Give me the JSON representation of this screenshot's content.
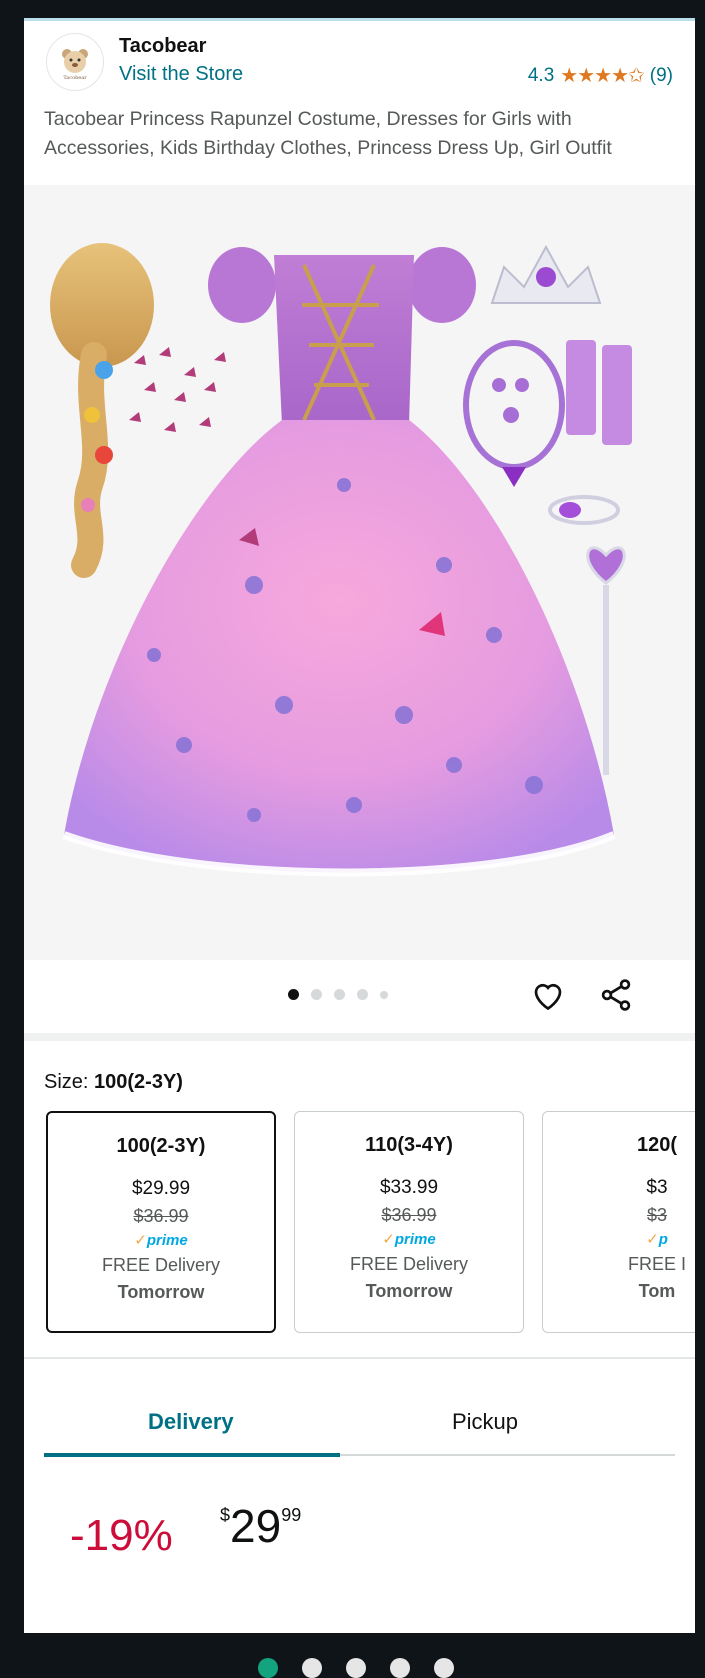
{
  "store": {
    "brand": "Tacobear",
    "visit": "Visit the Store",
    "rating": "4.3",
    "stars": "★★★★✩",
    "reviews": "(9)"
  },
  "product": {
    "title": "Tacobear Princess Rapunzel Costume, Dresses for Girls with Accessories, Kids Birthday Clothes, Princess Dress Up, Girl Outfit"
  },
  "gallery": {
    "image_count": 5,
    "active_index": 0
  },
  "size": {
    "label": "Size: ",
    "selected": "100(2-3Y)"
  },
  "size_options": [
    {
      "size": "100(2-3Y)",
      "price": "$29.99",
      "was": "$36.99",
      "prime": "prime",
      "delivery": "FREE Delivery",
      "when": "Tomorrow"
    },
    {
      "size": "110(3-4Y)",
      "price": "$33.99",
      "was": "$36.99",
      "prime": "prime",
      "delivery": "FREE Delivery",
      "when": "Tomorrow"
    },
    {
      "size": "120(",
      "price": "$3",
      "was": "$3",
      "prime": "p",
      "delivery": "FREE I",
      "when": "Tom"
    }
  ],
  "tabs": {
    "delivery": "Delivery",
    "pickup": "Pickup"
  },
  "deal": {
    "discount": "-19%",
    "currency": "$",
    "whole": "29",
    "fraction": "99"
  },
  "colors": {
    "link": "#007185",
    "star": "#de7921",
    "deal": "#cc0c39",
    "prime": "#00a8e1",
    "pager_active": "#14a37f"
  }
}
